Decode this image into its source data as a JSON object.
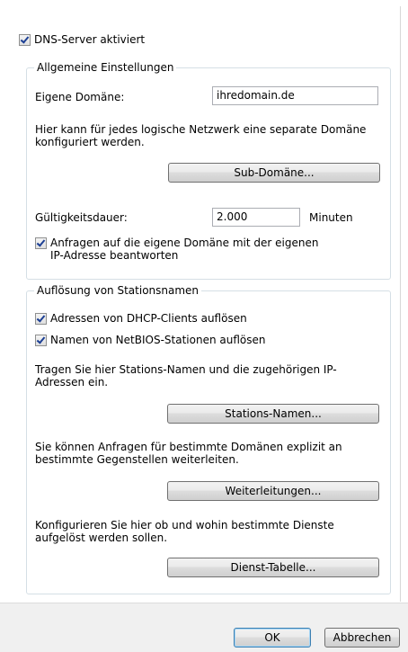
{
  "dns_enabled": {
    "label": "DNS-Server aktiviert",
    "checked": true
  },
  "general": {
    "legend": "Allgemeine Einstellungen",
    "own_domain_label": "Eigene Domäne:",
    "own_domain_value": "ihredomain.de",
    "info_text": "Hier kann für jedes logische Netzwerk eine separate Domäne konfiguriert werden.",
    "subdomain_button": "Sub-Domäne...",
    "validity_label": "Gültigkeitsdauer:",
    "validity_value": "2.000",
    "validity_unit": "Minuten",
    "answer_own_domain": {
      "label": "Anfragen auf die eigene Domäne mit der eigenen IP-Adresse beantworten",
      "checked": true
    }
  },
  "resolution": {
    "legend": "Auflösung von Stationsnamen",
    "dhcp": {
      "label": "Adressen von DHCP-Clients auflösen",
      "checked": true
    },
    "netbios": {
      "label": "Namen von NetBIOS-Stationen auflösen",
      "checked": true
    },
    "stations_text": "Tragen Sie hier Stations-Namen und die zugehörigen IP-Adressen ein.",
    "stations_button": "Stations-Namen...",
    "forward_text": "Sie können Anfragen für bestimmte Domänen explizit an bestimmte Gegenstellen weiterleiten.",
    "forward_button": "Weiterleitungen...",
    "services_text": "Konfigurieren Sie hier ob und wohin bestimmte Dienste aufgelöst werden sollen.",
    "services_button": "Dienst-Tabelle..."
  },
  "footer": {
    "ok_label": "OK",
    "cancel_label": "Abbrechen"
  }
}
